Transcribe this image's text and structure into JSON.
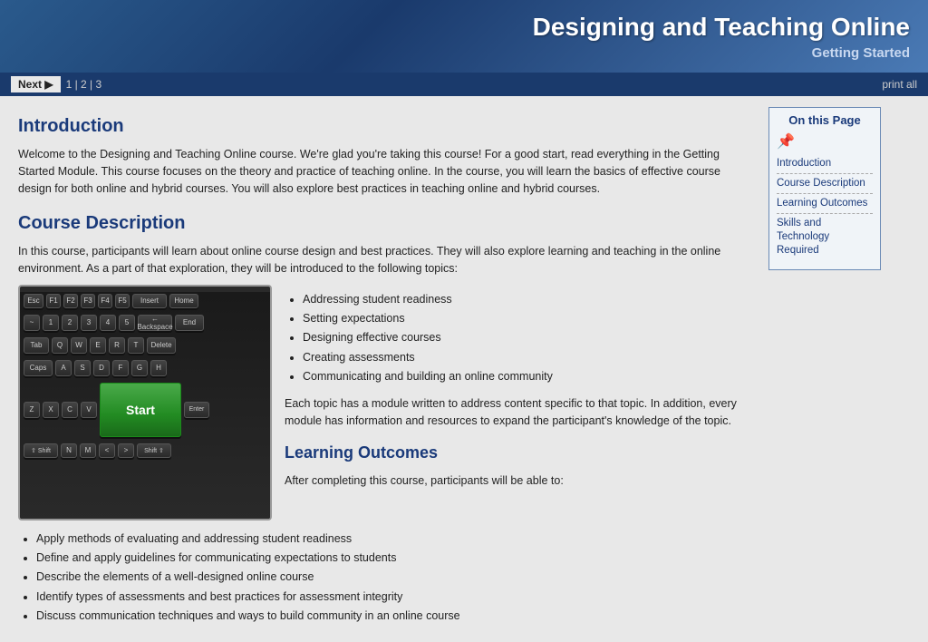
{
  "header": {
    "title": "Designing and Teaching Online",
    "subtitle": "Getting Started"
  },
  "navbar": {
    "next_label": "Next ▶",
    "pages": "1  |  2  |  3",
    "print_all": "print all"
  },
  "content": {
    "intro_heading": "Introduction",
    "intro_text": "Welcome to the Designing and Teaching Online course. We're glad you're taking this course! For a good start, read everything in the Getting Started Module.  This course focuses on the theory and practice of teaching online.  In the course, you will learn the basics of effective course design for both online and hybrid courses.  You will also explore best practices in teaching online and hybrid courses.",
    "course_desc_heading": "Course Description",
    "course_desc_intro": "In this course, participants will learn about online course design and best practices. They will also explore learning and teaching in the online environment. As a part of that exploration, they will be introduced to the following topics:",
    "course_desc_bullets": [
      "Addressing student readiness",
      "Setting expectations",
      "Designing effective courses",
      "Creating assessments",
      "Communicating and building an online community"
    ],
    "course_desc_followup": "Each topic has a module written to address content specific to that topic.  In addition, every module has information and resources to expand the participant's knowledge of the topic.",
    "learning_outcomes_heading": "Learning Outcomes",
    "learning_outcomes_intro": "After completing this course, participants will be able to:",
    "learning_outcomes_bullets": [
      "Apply methods of evaluating and addressing student readiness",
      "Define and apply guidelines for communicating expectations to students",
      "Describe the elements of a well-designed online course",
      "Identify types of assessments and best practices for assessment integrity",
      "Discuss communication techniques and ways to build community in an online course"
    ]
  },
  "sidebar": {
    "heading": "On this Page",
    "links": [
      "Introduction",
      "Course Description",
      "Learning Outcomes",
      "Skills and Technology Required"
    ]
  }
}
